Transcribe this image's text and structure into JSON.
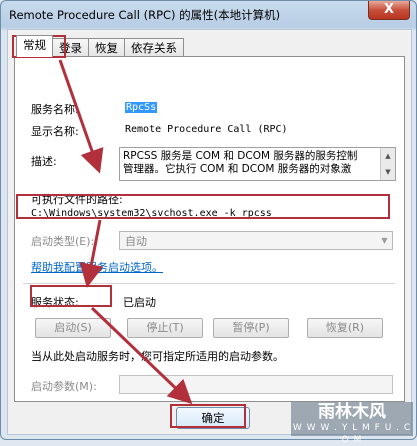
{
  "window": {
    "title": "Remote Procedure Call (RPC) 的属性(本地计算机)",
    "close_glyph": "X"
  },
  "tabs": [
    {
      "label": "常规",
      "active": true
    },
    {
      "label": "登录",
      "active": false
    },
    {
      "label": "恢复",
      "active": false
    },
    {
      "label": "依存关系",
      "active": false
    }
  ],
  "general": {
    "service_name_label": "服务名称:",
    "service_name_value": "RpcSs",
    "display_name_label": "显示名称:",
    "display_name_value": "Remote Procedure Call (RPC)",
    "description_label": "描述:",
    "description_line1": "RPCSS 服务是 COM 和 DCOM 服务器的服务控制",
    "description_line2": "管理器。它执行 COM 和 DCOM 服务器的对象激",
    "path_label": "可执行文件的路径:",
    "path_value": "C:\\Windows\\system32\\svchost.exe -k rpcss",
    "startup_type_label": "启动类型(E):",
    "startup_type_value": "自动",
    "help_link": "帮助我配置服务启动选项。",
    "status_label": "服务状态:",
    "status_value": "已启动",
    "buttons": {
      "start": "启动(S)",
      "stop": "停止(T)",
      "pause": "暂停(P)",
      "resume": "恢复(R)"
    },
    "hint": "当从此处启动服务时，您可指定所适用的启动参数。",
    "params_label": "启动参数(M):"
  },
  "footer": {
    "ok": "确定"
  },
  "watermark": {
    "main": "雨林木风",
    "sub": "W W W . Y L M F U . C O M"
  },
  "colors": {
    "annotation": "#b1303b",
    "link": "#0066cc",
    "selection": "#3399ff"
  }
}
